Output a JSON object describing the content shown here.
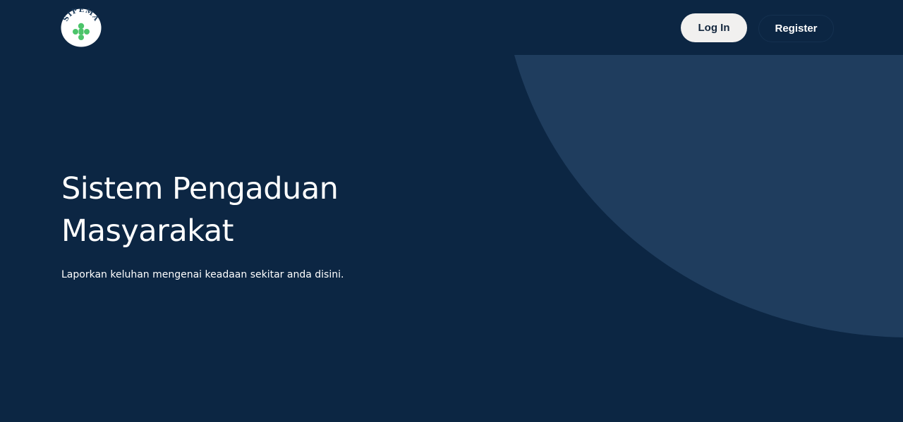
{
  "brand": {
    "logo_icon": "sipema-logo-icon",
    "logo_text": "SIPEMA"
  },
  "nav": {
    "login_label": "Log In",
    "register_label": "Register"
  },
  "hero": {
    "title_line1": "Sistem Pengaduan",
    "title_line2": "Masyarakat",
    "subtitle": "Laporkan keluhan mengenai keadaan sekitar anda disini."
  },
  "colors": {
    "background": "#0c2643",
    "accent_shape": "#1f3d5e",
    "login_button_bg": "#f1f0ef",
    "logo_green": "#4cc46a"
  }
}
